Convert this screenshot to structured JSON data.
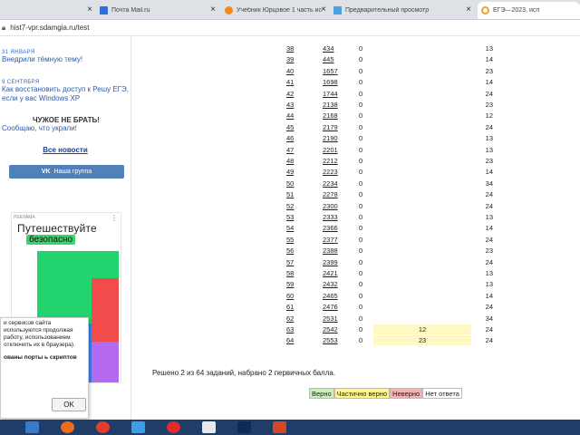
{
  "browser": {
    "tabs": [
      {
        "label": "",
        "close": "×",
        "active": false
      },
      {
        "label": "Почта Mail.ru",
        "close": "×",
        "active": false
      },
      {
        "label": "Учебник Юрцовое 1 часть ис",
        "close": "×",
        "active": false
      },
      {
        "label": "Предварительный просмотр",
        "close": "×",
        "active": false
      },
      {
        "label": "ЕГЭ—2023, исп",
        "close": "",
        "active": true
      }
    ],
    "url": "hist7-vpr.sdamgia.ru/test"
  },
  "sidebar": {
    "news": [
      {
        "date": "31 ЯНВАРЯ",
        "text": "Внедрили тёмную тему!"
      },
      {
        "date": "9 СЕНТЯБРЯ",
        "text": "Как восстановить доступ к Решу ЕГЭ, если у вас Windows XP"
      }
    ],
    "alert_title": "ЧУЖОЕ НЕ БРАТЬ!",
    "alert_text": "Сообщаю, что украли!",
    "all_news": "Все новости",
    "vk_mark": "VK",
    "vk_label": "Наша группа"
  },
  "ad": {
    "label": "РЕКЛАМА",
    "dots": "⋮",
    "title": "Путешествуйте",
    "subtitle": "безопасно"
  },
  "cookie": {
    "text": "и сервисов сайта используются продолжая работу, использованием отключить их в браузера).",
    "bold": "ованы порты ь скриптов",
    "ok": "OK"
  },
  "results": [
    {
      "num": "38",
      "code": "434",
      "ans": "0",
      "given": "",
      "pts": "13"
    },
    {
      "num": "39",
      "code": "445",
      "ans": "0",
      "given": "",
      "pts": "14"
    },
    {
      "num": "40",
      "code": "1657",
      "ans": "0",
      "given": "",
      "pts": "23"
    },
    {
      "num": "41",
      "code": "1698",
      "ans": "0",
      "given": "",
      "pts": "14"
    },
    {
      "num": "42",
      "code": "1744",
      "ans": "0",
      "given": "",
      "pts": "24"
    },
    {
      "num": "43",
      "code": "2138",
      "ans": "0",
      "given": "",
      "pts": "23"
    },
    {
      "num": "44",
      "code": "2168",
      "ans": "0",
      "given": "",
      "pts": "12"
    },
    {
      "num": "45",
      "code": "2179",
      "ans": "0",
      "given": "",
      "pts": "24"
    },
    {
      "num": "46",
      "code": "2190",
      "ans": "0",
      "given": "",
      "pts": "13"
    },
    {
      "num": "47",
      "code": "2201",
      "ans": "0",
      "given": "",
      "pts": "13"
    },
    {
      "num": "48",
      "code": "2212",
      "ans": "0",
      "given": "",
      "pts": "23"
    },
    {
      "num": "49",
      "code": "2223",
      "ans": "0",
      "given": "",
      "pts": "14"
    },
    {
      "num": "50",
      "code": "2234",
      "ans": "0",
      "given": "",
      "pts": "34"
    },
    {
      "num": "51",
      "code": "2278",
      "ans": "0",
      "given": "",
      "pts": "24"
    },
    {
      "num": "52",
      "code": "2300",
      "ans": "0",
      "given": "",
      "pts": "24"
    },
    {
      "num": "53",
      "code": "2333",
      "ans": "0",
      "given": "",
      "pts": "13"
    },
    {
      "num": "54",
      "code": "2366",
      "ans": "0",
      "given": "",
      "pts": "14"
    },
    {
      "num": "55",
      "code": "2377",
      "ans": "0",
      "given": "",
      "pts": "24"
    },
    {
      "num": "56",
      "code": "2388",
      "ans": "0",
      "given": "",
      "pts": "23"
    },
    {
      "num": "57",
      "code": "2399",
      "ans": "0",
      "given": "",
      "pts": "24"
    },
    {
      "num": "58",
      "code": "2421",
      "ans": "0",
      "given": "",
      "pts": "13"
    },
    {
      "num": "59",
      "code": "2432",
      "ans": "0",
      "given": "",
      "pts": "13"
    },
    {
      "num": "60",
      "code": "2465",
      "ans": "0",
      "given": "",
      "pts": "14"
    },
    {
      "num": "61",
      "code": "2476",
      "ans": "0",
      "given": "",
      "pts": "24"
    },
    {
      "num": "62",
      "code": "2531",
      "ans": "0",
      "given": "",
      "pts": "34"
    },
    {
      "num": "63",
      "code": "2542",
      "ans": "0",
      "given": "12",
      "pts": "24"
    },
    {
      "num": "64",
      "code": "2553",
      "ans": "0",
      "given": "23",
      "pts": "24"
    }
  ],
  "summary": "Решено 2 из 64 заданий, набрано 2 первичных балла.",
  "legend": {
    "correct": "Верно",
    "partial": "Частично верно",
    "wrong": "Неверно",
    "none": "Нет ответа"
  },
  "colors": {
    "correct": "#c8f2b6",
    "partial": "#fff58a",
    "wrong": "#f7b0b0",
    "taskbar": "#1f3d66"
  },
  "taskbar": {
    "icons": [
      "explorer-icon",
      "firefox-icon",
      "chrome-icon",
      "folder-icon",
      "yandex-icon",
      "mail-icon",
      "photoshop-icon",
      "powerpoint-icon"
    ]
  }
}
